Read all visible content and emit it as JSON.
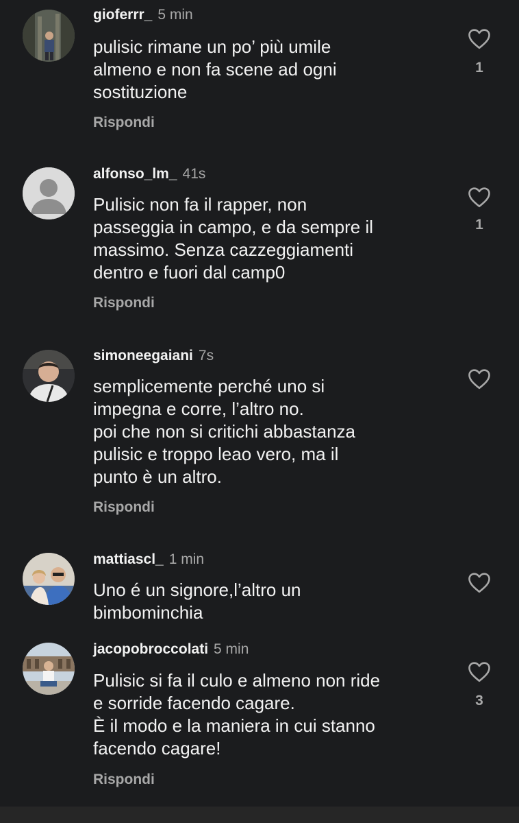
{
  "reply_label": "Rispondi",
  "comments": [
    {
      "username": "gioferrr_",
      "time": "5 min",
      "text": "pulisic rimane un po’ più umile\nalmeno e non fa scene ad ogni\nsostituzione",
      "likes": "1",
      "avatar": "avatar-photo-icon"
    },
    {
      "username": "alfonso_lm_",
      "time": "41s",
      "text": "Pulisic non fa il rapper, non\npasseggia in campo, e da sempre il\nmassimo. Senza cazzeggiamenti\ndentro e fuori dal camp0",
      "likes": "1",
      "avatar": "default-avatar-icon"
    },
    {
      "username": "simoneegaiani",
      "time": "7s",
      "text": "semplicemente perché uno si\nimpegna e corre, l’altro no.\npoi che non si critichi abbastanza\npulisic e troppo leao vero, ma il\npunto è un altro.",
      "likes": "",
      "avatar": "avatar-photo-icon"
    },
    {
      "username": "mattiascl_",
      "time": "1 min",
      "text": "Uno é un signore,l’altro un\nbimbominchia",
      "likes": "",
      "avatar": "avatar-photo-icon"
    },
    {
      "username": "jacopobroccolati",
      "time": "5 min",
      "text": "Pulisic si fa il culo e almeno non ride\ne sorride facendo cagare.\nÈ il modo e la maniera in cui stanno\nfacendo cagare!",
      "likes": "3",
      "avatar": "avatar-photo-icon"
    }
  ],
  "colors": {
    "background": "#1b1c1e",
    "primary_text": "#f2f2f2",
    "secondary_text": "#a8a8a8"
  }
}
